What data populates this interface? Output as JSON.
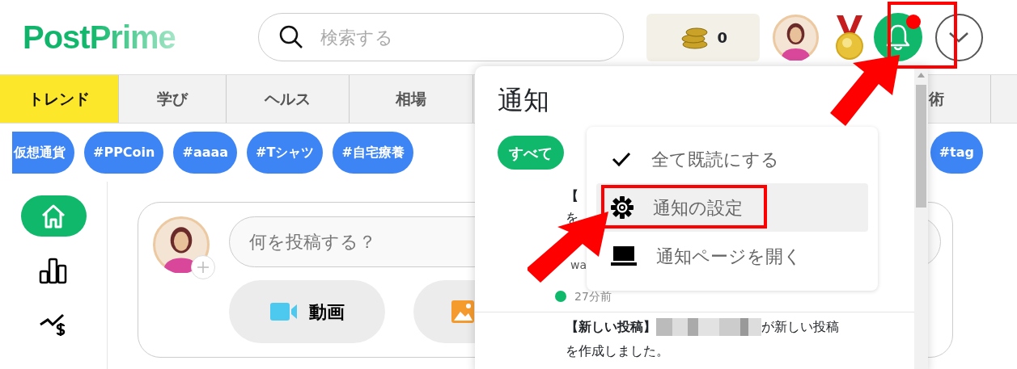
{
  "header": {
    "logo": "PostPrime",
    "search": {
      "placeholder": "検索する"
    },
    "coins": "0",
    "bell": {
      "unread": true,
      "highlighted": true
    }
  },
  "categories": [
    {
      "label": "トレンド",
      "selected": true
    },
    {
      "label": "学び",
      "selected": false
    },
    {
      "label": "ヘルス",
      "selected": false
    },
    {
      "label": "相場",
      "selected": false
    },
    {
      "label": "術",
      "selected": false
    }
  ],
  "tags": [
    "仮想通貨",
    "#PPCoin",
    "#aaaa",
    "#Tシャツ",
    "#自宅療養",
    "#tag"
  ],
  "sidebar": [
    {
      "kind": "home",
      "selected": true
    },
    {
      "kind": "ranking",
      "selected": false
    },
    {
      "kind": "market",
      "selected": false
    }
  ],
  "composer": {
    "placeholder": "何を投稿する？",
    "buttons": [
      {
        "kind": "video",
        "label": "動画"
      },
      {
        "kind": "photo"
      }
    ]
  },
  "notifications_panel": {
    "title": "通知",
    "filters": [
      {
        "label": "すべて",
        "selected": true
      }
    ],
    "items": [
      {
        "title": "【",
        "lines": [
          "を",
          "wa"
        ],
        "time": "27分前",
        "unread": true
      },
      {
        "title": "【新しい投稿】",
        "lines": [
          "が新しい投稿",
          "を作成しました。"
        ],
        "redacted": true
      }
    ]
  },
  "menu": [
    {
      "kind": "check",
      "label": "全て既読にする",
      "hovered": false,
      "highlighted": false
    },
    {
      "kind": "gear",
      "label": "通知の設定",
      "hovered": true,
      "highlighted": true
    },
    {
      "kind": "laptop",
      "label": "通知ページを開く",
      "hovered": false,
      "highlighted": false
    }
  ]
}
